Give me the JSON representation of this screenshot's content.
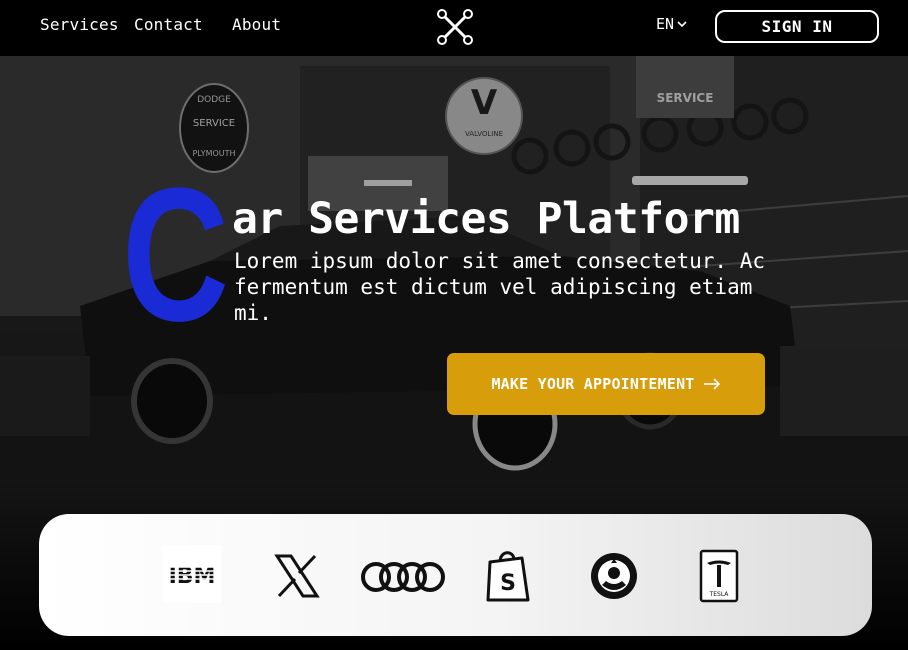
{
  "nav": {
    "links": [
      "Services",
      "Contact",
      "About"
    ],
    "lang": "EN",
    "signin_label": "SIGN IN"
  },
  "hero": {
    "initial": "C",
    "title_rest": "ar Services Platform",
    "subtitle": "Lorem ipsum dolor sit amet consectetur. Ac fermentum est dictum vel adipiscing etiam mi.",
    "cta_label": "MAKE YOUR APPOINTEMENT",
    "cta_icon": "arrow-right-icon",
    "sign_text_1": "SERVICE",
    "sign_text_2": "PLYMOUTH",
    "sign_text_3": "VALVOLINE",
    "sign_text_4": "DODGE"
  },
  "partners": [
    {
      "name": "IBM",
      "icon": "ibm-logo"
    },
    {
      "name": "X",
      "icon": "x-logo"
    },
    {
      "name": "Audi",
      "icon": "audi-logo"
    },
    {
      "name": "Shopify",
      "icon": "shopify-logo"
    },
    {
      "name": "Starbucks",
      "icon": "starbucks-logo"
    },
    {
      "name": "TESLA",
      "icon": "tesla-logo"
    }
  ],
  "colors": {
    "accent_blue": "#1a2ad4",
    "cta_yellow": "#d79d0a",
    "nav_bg": "#000000"
  }
}
